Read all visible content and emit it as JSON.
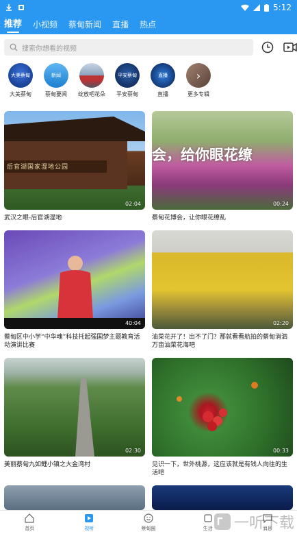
{
  "status_bar": {
    "time": "5:12"
  },
  "tabs": [
    {
      "label": "推荐",
      "active": true
    },
    {
      "label": "小视频",
      "active": false
    },
    {
      "label": "蔡甸新闻",
      "active": false
    },
    {
      "label": "直播",
      "active": false
    },
    {
      "label": "热点",
      "active": false
    }
  ],
  "search": {
    "placeholder": "搜索你想看的视频"
  },
  "channels": [
    {
      "label": "大美蔡甸",
      "icon_text": "大美蔡甸"
    },
    {
      "label": "蔡甸要闻",
      "icon_text": "新闻"
    },
    {
      "label": "绽放吧花朵",
      "icon_text": ""
    },
    {
      "label": "平安蔡甸",
      "icon_text": "平安蔡甸"
    },
    {
      "label": "直播",
      "icon_text": "直播"
    },
    {
      "label": "更多专辑",
      "icon_text": "›"
    }
  ],
  "videos": [
    {
      "caption": "武汉之眼-后官湖湿地",
      "duration": "02:04",
      "overlay": "后官湖国家湿地公园"
    },
    {
      "caption": "蔡甸花博会，让你眼花缭乱",
      "duration": "00:24",
      "overlay": "会，给你眼花缭"
    },
    {
      "caption": "蔡甸区中小学“中华魂”科技托起强国梦主题教育活动演讲比赛",
      "duration": "40:04",
      "overlay": ""
    },
    {
      "caption": "油菜花开了！出不了门？那就看看航拍的蔡甸消泗万亩油菜花海吧",
      "duration": "02:20",
      "overlay": ""
    },
    {
      "caption": "美丽蔡甸九如鲤小镇之大金湾村",
      "duration": "02:30",
      "overlay": ""
    },
    {
      "caption": "见识一下，世外桃源，这应该就是有钱人向往的生活吧",
      "duration": "00:33",
      "overlay": ""
    }
  ],
  "bottom_nav": [
    {
      "label": "首页",
      "active": false,
      "icon": "home-icon"
    },
    {
      "label": "视听",
      "active": true,
      "icon": "play-icon"
    },
    {
      "label": "蔡甸圈",
      "active": false,
      "icon": "smile-icon"
    },
    {
      "label": "生活",
      "active": false,
      "icon": "life-icon"
    },
    {
      "label": "消息",
      "active": false,
      "icon": "message-icon"
    }
  ],
  "watermark": "一听下载"
}
